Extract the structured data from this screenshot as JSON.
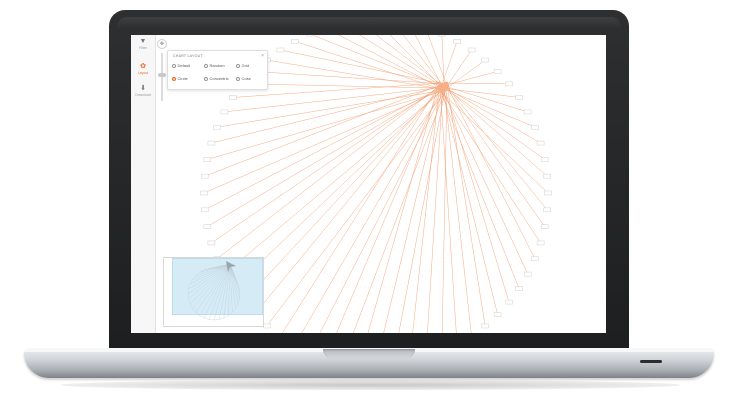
{
  "toolbar": {
    "items": [
      {
        "label": "Filter",
        "icon": "filter-icon",
        "active": false
      },
      {
        "label": "Layout",
        "icon": "layout-icon",
        "active": true
      },
      {
        "label": "Download",
        "icon": "download-icon",
        "active": false
      }
    ]
  },
  "zoom": {
    "pan_icon": "move-icon",
    "level": 0.55
  },
  "layout_dialog": {
    "title": "CHART LAYOUT",
    "close": "×",
    "options": [
      {
        "label": "Default",
        "selected": false
      },
      {
        "label": "Random",
        "selected": false
      },
      {
        "label": "Grid",
        "selected": false
      },
      {
        "label": "Circle",
        "selected": true
      },
      {
        "label": "Concentric",
        "selected": false
      },
      {
        "label": "Cose",
        "selected": false
      }
    ]
  },
  "graph": {
    "layout": "circle",
    "outer_node_count": 64,
    "hub_count": 10,
    "edge_color": "#f39a6a",
    "node_color": "#ffffff",
    "node_border": "#cfcfcf"
  },
  "colors": {
    "accent": "#f06a2b",
    "laptop_bezel": "#1f2022",
    "minimap_fill": "#d5ecf7"
  }
}
